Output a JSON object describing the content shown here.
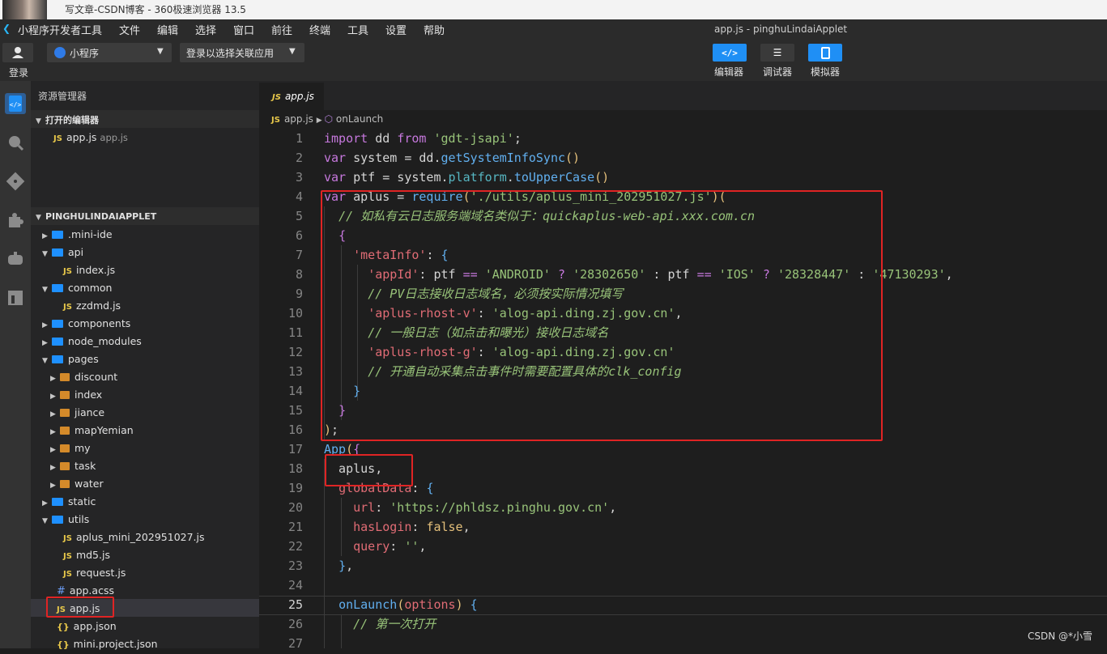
{
  "browser": {
    "title": "写文章-CSDN博客 - 360极速浏览器 13.5"
  },
  "menu": {
    "app_name": "小程序开发者工具",
    "items": [
      "文件",
      "编辑",
      "选择",
      "窗口",
      "前往",
      "终端",
      "工具",
      "设置",
      "帮助"
    ],
    "window_title": "app.js - pinghuLindaiApplet"
  },
  "toolbar": {
    "login_label": "登录",
    "mode_select": "小程序",
    "login_select": "登录以选择关联应用",
    "buttons": [
      {
        "label": "编辑器",
        "icon": "code-icon",
        "color": "#1f8ff5"
      },
      {
        "label": "调试器",
        "icon": "sliders-icon",
        "color": "#3a3a3a"
      },
      {
        "label": "模拟器",
        "icon": "phone-icon",
        "color": "#1f8ff5"
      }
    ]
  },
  "activity": {
    "icons": [
      "explorer-icon",
      "search-icon",
      "git-icon",
      "extensions-icon",
      "debug-icon",
      "panel-icon"
    ]
  },
  "sidebar": {
    "title": "资源管理器",
    "open_editors_label": "打开的编辑器",
    "open_editor_file": "app.js",
    "open_editor_path": "app.js",
    "project_label": "PINGHULINDAIAPPLET",
    "tree": [
      {
        "label": ".mini-ide",
        "type": "folder",
        "open": false,
        "depth": 1
      },
      {
        "label": "api",
        "type": "folder",
        "open": true,
        "depth": 1
      },
      {
        "label": "index.js",
        "type": "js",
        "depth": 2
      },
      {
        "label": "common",
        "type": "folder",
        "open": true,
        "depth": 1
      },
      {
        "label": "zzdmd.js",
        "type": "js",
        "depth": 2
      },
      {
        "label": "components",
        "type": "folder",
        "open": false,
        "depth": 1
      },
      {
        "label": "node_modules",
        "type": "folder",
        "open": false,
        "depth": 1
      },
      {
        "label": "pages",
        "type": "folder",
        "open": true,
        "depth": 1
      },
      {
        "label": "discount",
        "type": "page",
        "open": false,
        "depth": 2
      },
      {
        "label": "index",
        "type": "page",
        "open": false,
        "depth": 2
      },
      {
        "label": "jiance",
        "type": "page",
        "open": false,
        "depth": 2
      },
      {
        "label": "mapYemian",
        "type": "page",
        "open": false,
        "depth": 2
      },
      {
        "label": "my",
        "type": "page",
        "open": false,
        "depth": 2
      },
      {
        "label": "task",
        "type": "page",
        "open": false,
        "depth": 2
      },
      {
        "label": "water",
        "type": "page",
        "open": false,
        "depth": 2
      },
      {
        "label": "static",
        "type": "folder",
        "open": false,
        "depth": 1
      },
      {
        "label": "utils",
        "type": "folder",
        "open": true,
        "depth": 1
      },
      {
        "label": "aplus_mini_202951027.js",
        "type": "js",
        "depth": 2
      },
      {
        "label": "md5.js",
        "type": "js",
        "depth": 2
      },
      {
        "label": "request.js",
        "type": "js",
        "depth": 2
      },
      {
        "label": "app.acss",
        "type": "css",
        "depth": 1
      },
      {
        "label": "app.js",
        "type": "js",
        "depth": 1,
        "selected": true
      },
      {
        "label": "app.json",
        "type": "json",
        "depth": 1
      },
      {
        "label": "mini.project.json",
        "type": "json",
        "depth": 1
      }
    ]
  },
  "editor": {
    "tab_label": "app.js",
    "tab_badge": "JS",
    "breadcrumb_file": "app.js",
    "breadcrumb_symbol": "onLaunch",
    "current_line": 25,
    "lines": [
      {
        "n": 1,
        "tokens": [
          [
            "k",
            "import"
          ],
          [
            "p",
            " dd "
          ],
          [
            "k",
            "from"
          ],
          [
            "p",
            " "
          ],
          [
            "s",
            "'gdt-jsapi'"
          ],
          [
            "p",
            ";"
          ]
        ]
      },
      {
        "n": 2,
        "tokens": [
          [
            "k",
            "var"
          ],
          [
            "p",
            " system = dd."
          ],
          [
            "f",
            "getSystemInfoSync"
          ],
          [
            "v",
            "()"
          ]
        ]
      },
      {
        "n": 3,
        "tokens": [
          [
            "k",
            "var"
          ],
          [
            "p",
            " ptf = system."
          ],
          [
            "o",
            "platform"
          ],
          [
            "p",
            "."
          ],
          [
            "f",
            "toUpperCase"
          ],
          [
            "v",
            "()"
          ]
        ]
      },
      {
        "n": 4,
        "tokens": [
          [
            "k",
            "var"
          ],
          [
            "p",
            " aplus = "
          ],
          [
            "f",
            "require"
          ],
          [
            "v",
            "("
          ],
          [
            "s",
            "'./utils/aplus_mini_202951027.js'"
          ],
          [
            "v",
            ")("
          ]
        ]
      },
      {
        "n": 5,
        "tokens": [
          [
            "p",
            "  "
          ],
          [
            "c",
            "// 如私有云日志服务端域名类似于：quickaplus-web-api.xxx.com.cn"
          ]
        ]
      },
      {
        "n": 6,
        "tokens": [
          [
            "p",
            "  "
          ],
          [
            "k",
            "{"
          ]
        ]
      },
      {
        "n": 7,
        "tokens": [
          [
            "p",
            "    "
          ],
          [
            "pr",
            "'metaInfo'"
          ],
          [
            "p",
            ": "
          ],
          [
            "f",
            "{"
          ]
        ]
      },
      {
        "n": 8,
        "tokens": [
          [
            "p",
            "      "
          ],
          [
            "pr",
            "'appId'"
          ],
          [
            "p",
            ": ptf "
          ],
          [
            "k",
            "=="
          ],
          [
            "p",
            " "
          ],
          [
            "s",
            "'ANDROID'"
          ],
          [
            "p",
            " "
          ],
          [
            "k",
            "?"
          ],
          [
            "p",
            " "
          ],
          [
            "s",
            "'28302650'"
          ],
          [
            "p",
            " : ptf "
          ],
          [
            "k",
            "=="
          ],
          [
            "p",
            " "
          ],
          [
            "s",
            "'IOS'"
          ],
          [
            "p",
            " "
          ],
          [
            "k",
            "?"
          ],
          [
            "p",
            " "
          ],
          [
            "s",
            "'28328447'"
          ],
          [
            "p",
            " : "
          ],
          [
            "s",
            "'47130293'"
          ],
          [
            "p",
            ","
          ]
        ]
      },
      {
        "n": 9,
        "tokens": [
          [
            "p",
            "      "
          ],
          [
            "c",
            "// PV日志接收日志域名，必须按实际情况填写"
          ]
        ]
      },
      {
        "n": 10,
        "tokens": [
          [
            "p",
            "      "
          ],
          [
            "pr",
            "'aplus-rhost-v'"
          ],
          [
            "p",
            ": "
          ],
          [
            "s",
            "'alog-api.ding.zj.gov.cn'"
          ],
          [
            "p",
            ","
          ]
        ]
      },
      {
        "n": 11,
        "tokens": [
          [
            "p",
            "      "
          ],
          [
            "c",
            "// 一般日志（如点击和曝光）接收日志域名"
          ]
        ]
      },
      {
        "n": 12,
        "tokens": [
          [
            "p",
            "      "
          ],
          [
            "pr",
            "'aplus-rhost-g'"
          ],
          [
            "p",
            ": "
          ],
          [
            "s",
            "'alog-api.ding.zj.gov.cn'"
          ]
        ]
      },
      {
        "n": 13,
        "tokens": [
          [
            "p",
            "      "
          ],
          [
            "c",
            "// 开通自动采集点击事件时需要配置具体的clk_config"
          ]
        ]
      },
      {
        "n": 14,
        "tokens": [
          [
            "p",
            "    "
          ],
          [
            "f",
            "}"
          ]
        ]
      },
      {
        "n": 15,
        "tokens": [
          [
            "p",
            "  "
          ],
          [
            "k",
            "}"
          ]
        ]
      },
      {
        "n": 16,
        "tokens": [
          [
            "v",
            ")"
          ],
          [
            "p",
            ";"
          ]
        ]
      },
      {
        "n": 17,
        "tokens": [
          [
            "f",
            "App"
          ],
          [
            "v",
            "("
          ],
          [
            "k",
            "{"
          ]
        ]
      },
      {
        "n": 18,
        "tokens": [
          [
            "p",
            "  aplus,"
          ]
        ]
      },
      {
        "n": 19,
        "tokens": [
          [
            "p",
            "  "
          ],
          [
            "pr",
            "globalData"
          ],
          [
            "p",
            ": "
          ],
          [
            "f",
            "{"
          ]
        ]
      },
      {
        "n": 20,
        "tokens": [
          [
            "p",
            "    "
          ],
          [
            "pr",
            "url"
          ],
          [
            "p",
            ": "
          ],
          [
            "s",
            "'https://phldsz.pinghu.gov.cn'"
          ],
          [
            "p",
            ","
          ]
        ]
      },
      {
        "n": 21,
        "tokens": [
          [
            "p",
            "    "
          ],
          [
            "pr",
            "hasLogin"
          ],
          [
            "p",
            ": "
          ],
          [
            "y",
            "false"
          ],
          [
            "p",
            ","
          ]
        ]
      },
      {
        "n": 22,
        "tokens": [
          [
            "p",
            "    "
          ],
          [
            "pr",
            "query"
          ],
          [
            "p",
            ": "
          ],
          [
            "s",
            "''"
          ],
          [
            "p",
            ","
          ]
        ]
      },
      {
        "n": 23,
        "tokens": [
          [
            "p",
            "  "
          ],
          [
            "f",
            "}"
          ],
          [
            "p",
            ","
          ]
        ]
      },
      {
        "n": 24,
        "tokens": []
      },
      {
        "n": 25,
        "tokens": [
          [
            "p",
            "  "
          ],
          [
            "f",
            "onLaunch"
          ],
          [
            "v",
            "("
          ],
          [
            "pr",
            "options"
          ],
          [
            "v",
            ")"
          ],
          [
            "p",
            " "
          ],
          [
            "f",
            "{"
          ]
        ]
      },
      {
        "n": 26,
        "tokens": [
          [
            "p",
            "    "
          ],
          [
            "c",
            "// 第一次打开"
          ]
        ]
      },
      {
        "n": 27,
        "tokens": []
      }
    ]
  },
  "watermark": "CSDN @*小雪"
}
